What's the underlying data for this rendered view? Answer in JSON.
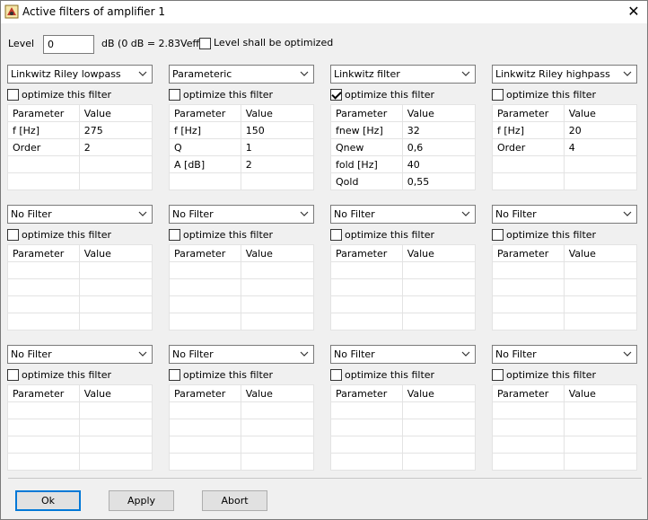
{
  "window": {
    "title": "Active filters of amplifier 1",
    "close_glyph": "✕"
  },
  "level": {
    "label": "Level",
    "value": "0",
    "unit_text": "dB (0 dB = 2.83Veff)",
    "optimize_label": "Level shall be optimized",
    "optimize_checked": false
  },
  "filters": [
    {
      "type": "Linkwitz Riley lowpass",
      "optimize_label": "optimize this filter",
      "optimize_checked": false,
      "header": [
        "Parameter",
        "Value"
      ],
      "rows": [
        [
          "f [Hz]",
          "275"
        ],
        [
          "Order",
          "2"
        ],
        [
          "",
          ""
        ],
        [
          "",
          ""
        ]
      ]
    },
    {
      "type": "Parameteric",
      "optimize_label": "optimize this filter",
      "optimize_checked": false,
      "header": [
        "Parameter",
        "Value"
      ],
      "rows": [
        [
          "f [Hz]",
          "150"
        ],
        [
          "Q",
          "1"
        ],
        [
          "A [dB]",
          "2"
        ],
        [
          "",
          ""
        ]
      ]
    },
    {
      "type": "Linkwitz filter",
      "optimize_label": "optimize this filter",
      "optimize_checked": true,
      "header": [
        "Parameter",
        "Value"
      ],
      "rows": [
        [
          "fnew [Hz]",
          "32"
        ],
        [
          "Qnew",
          "0,6"
        ],
        [
          "fold [Hz]",
          "40"
        ],
        [
          "Qold",
          "0,55"
        ]
      ]
    },
    {
      "type": "Linkwitz Riley highpass",
      "optimize_label": "optimize this filter",
      "optimize_checked": false,
      "header": [
        "Parameter",
        "Value"
      ],
      "rows": [
        [
          "f [Hz]",
          "20"
        ],
        [
          "Order",
          "4"
        ],
        [
          "",
          ""
        ],
        [
          "",
          ""
        ]
      ]
    },
    {
      "type": "No Filter",
      "optimize_label": "optimize this filter",
      "optimize_checked": false,
      "header": [
        "Parameter",
        "Value"
      ],
      "rows": [
        [
          "",
          ""
        ],
        [
          "",
          ""
        ],
        [
          "",
          ""
        ],
        [
          "",
          ""
        ]
      ]
    },
    {
      "type": "No Filter",
      "optimize_label": "optimize this filter",
      "optimize_checked": false,
      "header": [
        "Parameter",
        "Value"
      ],
      "rows": [
        [
          "",
          ""
        ],
        [
          "",
          ""
        ],
        [
          "",
          ""
        ],
        [
          "",
          ""
        ]
      ]
    },
    {
      "type": "No Filter",
      "optimize_label": "optimize this filter",
      "optimize_checked": false,
      "header": [
        "Parameter",
        "Value"
      ],
      "rows": [
        [
          "",
          ""
        ],
        [
          "",
          ""
        ],
        [
          "",
          ""
        ],
        [
          "",
          ""
        ]
      ]
    },
    {
      "type": "No Filter",
      "optimize_label": "optimize this filter",
      "optimize_checked": false,
      "header": [
        "Parameter",
        "Value"
      ],
      "rows": [
        [
          "",
          ""
        ],
        [
          "",
          ""
        ],
        [
          "",
          ""
        ],
        [
          "",
          ""
        ]
      ]
    },
    {
      "type": "No Filter",
      "optimize_label": "optimize this filter",
      "optimize_checked": false,
      "header": [
        "Parameter",
        "Value"
      ],
      "rows": [
        [
          "",
          ""
        ],
        [
          "",
          ""
        ],
        [
          "",
          ""
        ],
        [
          "",
          ""
        ]
      ]
    },
    {
      "type": "No Filter",
      "optimize_label": "optimize this filter",
      "optimize_checked": false,
      "header": [
        "Parameter",
        "Value"
      ],
      "rows": [
        [
          "",
          ""
        ],
        [
          "",
          ""
        ],
        [
          "",
          ""
        ],
        [
          "",
          ""
        ]
      ]
    },
    {
      "type": "No Filter",
      "optimize_label": "optimize this filter",
      "optimize_checked": false,
      "header": [
        "Parameter",
        "Value"
      ],
      "rows": [
        [
          "",
          ""
        ],
        [
          "",
          ""
        ],
        [
          "",
          ""
        ],
        [
          "",
          ""
        ]
      ]
    },
    {
      "type": "No Filter",
      "optimize_label": "optimize this filter",
      "optimize_checked": false,
      "header": [
        "Parameter",
        "Value"
      ],
      "rows": [
        [
          "",
          ""
        ],
        [
          "",
          ""
        ],
        [
          "",
          ""
        ],
        [
          "",
          ""
        ]
      ]
    }
  ],
  "buttons": {
    "ok": "Ok",
    "apply": "Apply",
    "abort": "Abort"
  },
  "colors": {
    "focus_border": "#0078d7",
    "window_bg": "#f0f0f0"
  }
}
